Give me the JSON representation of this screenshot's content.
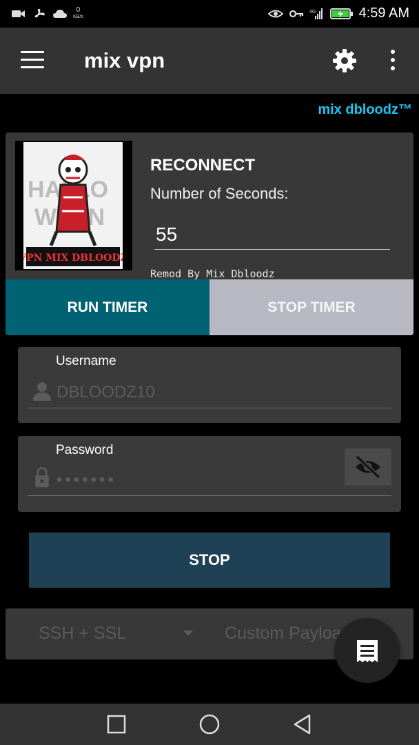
{
  "status_bar": {
    "net_speed_value": "0",
    "net_speed_unit": "KB/s",
    "network_type": "4G",
    "time": "4:59 AM"
  },
  "toolbar": {
    "title": "mix vpn",
    "menu_icon": "hamburger-menu-icon",
    "settings_icon": "gear-icon",
    "overflow_icon": "more-vertical-icon"
  },
  "brand": {
    "text": "mix dbloodz™"
  },
  "reconnect": {
    "title": "RECONNECT",
    "seconds_label": "Number of Seconds:",
    "seconds_value": "55",
    "remod_text": "Remod By Mix Dbloodz",
    "run_button": "RUN TIMER",
    "stop_button": "STOP TIMER",
    "logo_text": "VPN MIX DBLOODZ"
  },
  "credentials": {
    "username_label": "Username",
    "username_value": "DBLOODZ10",
    "password_label": "Password",
    "password_value": "•••••••"
  },
  "main_button": {
    "label": "STOP"
  },
  "selectors": {
    "protocol": "SSH + SSL",
    "payload": "Custom Payload"
  },
  "colors": {
    "toolbar_bg": "#333334",
    "brand_accent": "#19c6f0",
    "run_timer_bg": "#006272",
    "stop_timer_bg": "#b7b8c2",
    "stop_button_bg": "#1f4155",
    "card_bg": "#383838"
  }
}
